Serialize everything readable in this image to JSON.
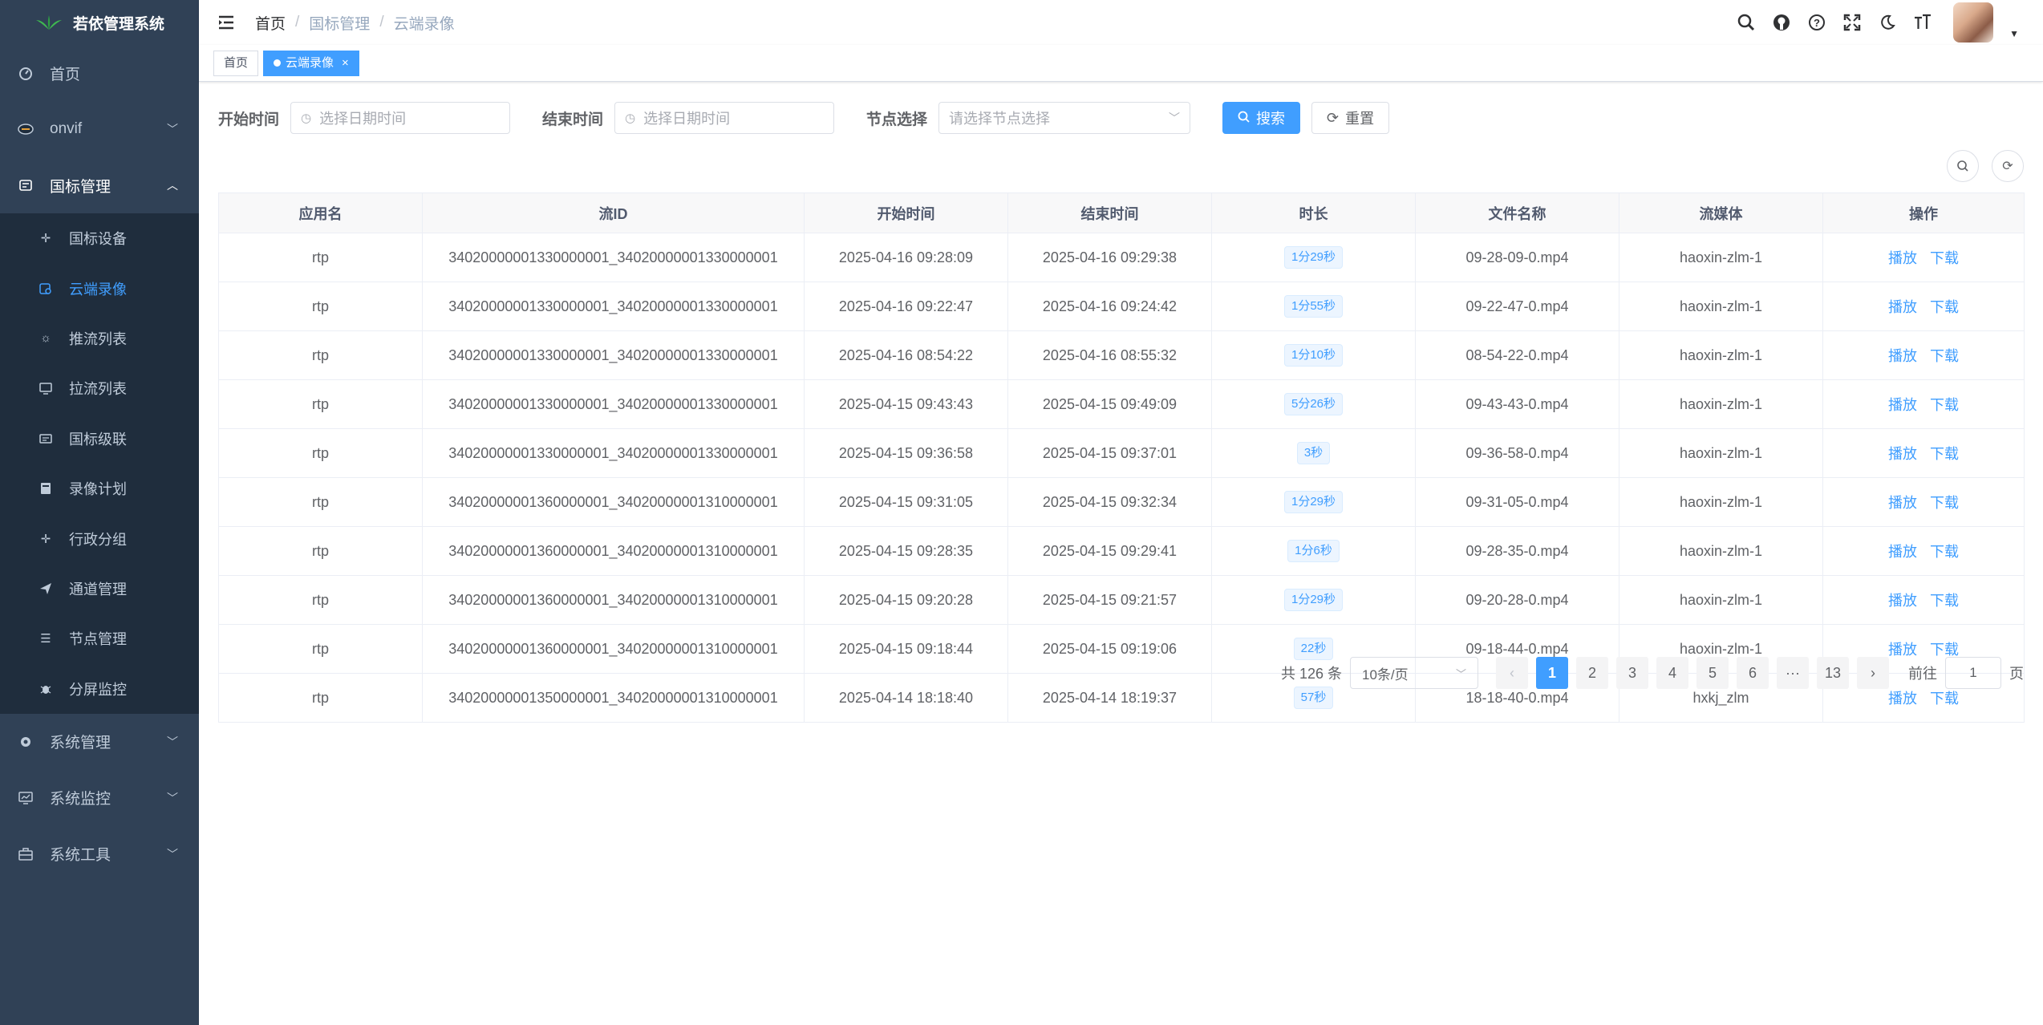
{
  "app": {
    "title": "若依管理系统"
  },
  "sidebar": {
    "items": [
      {
        "label": "首页",
        "icon": "dashboard-icon"
      },
      {
        "label": "onvif",
        "icon": "onvif-icon"
      },
      {
        "label": "国标管理",
        "icon": "gb-icon"
      }
    ],
    "submenu": [
      {
        "label": "国标设备",
        "icon": "device-icon"
      },
      {
        "label": "云端录像",
        "icon": "cloud-record-icon"
      },
      {
        "label": "推流列表",
        "icon": "push-icon"
      },
      {
        "label": "拉流列表",
        "icon": "pull-icon"
      },
      {
        "label": "国标级联",
        "icon": "cascade-icon"
      },
      {
        "label": "录像计划",
        "icon": "plan-icon"
      },
      {
        "label": "行政分组",
        "icon": "group-icon"
      },
      {
        "label": "通道管理",
        "icon": "channel-icon"
      },
      {
        "label": "节点管理",
        "icon": "node-icon"
      },
      {
        "label": "分屏监控",
        "icon": "monitor-icon"
      }
    ],
    "bottom": [
      {
        "label": "系统管理",
        "icon": "settings-icon"
      },
      {
        "label": "系统监控",
        "icon": "monitor-chart-icon"
      },
      {
        "label": "系统工具",
        "icon": "toolbox-icon"
      }
    ]
  },
  "breadcrumb": [
    "首页",
    "国标管理",
    "云端录像"
  ],
  "tags": {
    "home": "首页",
    "current": "云端录像"
  },
  "search": {
    "start_label": "开始时间",
    "start_placeholder": "选择日期时间",
    "end_label": "结束时间",
    "end_placeholder": "选择日期时间",
    "node_label": "节点选择",
    "node_placeholder": "请选择节点选择",
    "search_btn": "搜索",
    "reset_btn": "重置"
  },
  "table": {
    "columns": [
      "应用名",
      "流ID",
      "开始时间",
      "结束时间",
      "时长",
      "文件名称",
      "流媒体",
      "操作"
    ],
    "rows": [
      [
        "rtp",
        "34020000001330000001_34020000001330000001",
        "2025-04-16 09:28:09",
        "2025-04-16 09:29:38",
        "1分29秒",
        "09-28-09-0.mp4",
        "haoxin-zlm-1"
      ],
      [
        "rtp",
        "34020000001330000001_34020000001330000001",
        "2025-04-16 09:22:47",
        "2025-04-16 09:24:42",
        "1分55秒",
        "09-22-47-0.mp4",
        "haoxin-zlm-1"
      ],
      [
        "rtp",
        "34020000001330000001_34020000001330000001",
        "2025-04-16 08:54:22",
        "2025-04-16 08:55:32",
        "1分10秒",
        "08-54-22-0.mp4",
        "haoxin-zlm-1"
      ],
      [
        "rtp",
        "34020000001330000001_34020000001330000001",
        "2025-04-15 09:43:43",
        "2025-04-15 09:49:09",
        "5分26秒",
        "09-43-43-0.mp4",
        "haoxin-zlm-1"
      ],
      [
        "rtp",
        "34020000001330000001_34020000001330000001",
        "2025-04-15 09:36:58",
        "2025-04-15 09:37:01",
        "3秒",
        "09-36-58-0.mp4",
        "haoxin-zlm-1"
      ],
      [
        "rtp",
        "34020000001360000001_34020000001310000001",
        "2025-04-15 09:31:05",
        "2025-04-15 09:32:34",
        "1分29秒",
        "09-31-05-0.mp4",
        "haoxin-zlm-1"
      ],
      [
        "rtp",
        "34020000001360000001_34020000001310000001",
        "2025-04-15 09:28:35",
        "2025-04-15 09:29:41",
        "1分6秒",
        "09-28-35-0.mp4",
        "haoxin-zlm-1"
      ],
      [
        "rtp",
        "34020000001360000001_34020000001310000001",
        "2025-04-15 09:20:28",
        "2025-04-15 09:21:57",
        "1分29秒",
        "09-20-28-0.mp4",
        "haoxin-zlm-1"
      ],
      [
        "rtp",
        "34020000001360000001_34020000001310000001",
        "2025-04-15 09:18:44",
        "2025-04-15 09:19:06",
        "22秒",
        "09-18-44-0.mp4",
        "haoxin-zlm-1"
      ],
      [
        "rtp",
        "34020000001350000001_34020000001310000001",
        "2025-04-14 18:18:40",
        "2025-04-14 18:19:37",
        "57秒",
        "18-18-40-0.mp4",
        "hxkj_zlm"
      ]
    ],
    "ops": {
      "play": "播放",
      "download": "下载"
    }
  },
  "pagination": {
    "total": "共 126 条",
    "page_size": "10条/页",
    "pages": [
      "1",
      "2",
      "3",
      "4",
      "5",
      "6",
      "···",
      "13"
    ],
    "goto_label": "前往",
    "goto_value": "1",
    "goto_suffix": "页"
  },
  "colors": {
    "sidebar_bg": "#304156",
    "submenu_bg": "#1f2d3d",
    "accent": "#409eff"
  }
}
